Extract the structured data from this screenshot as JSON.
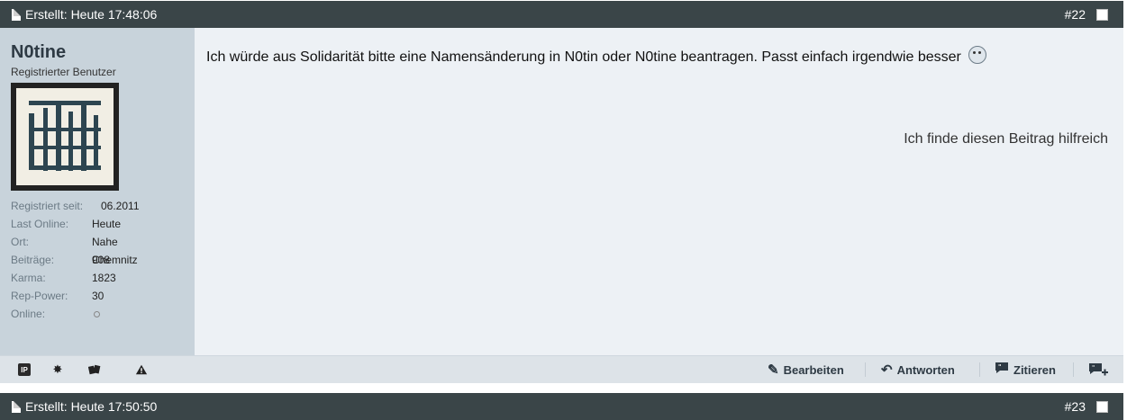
{
  "post1": {
    "created": "Erstellt: Heute 17:48:06",
    "number": "#22",
    "user": {
      "name": "N0tine",
      "title": "Registrierter Benutzer",
      "stats": [
        {
          "label": "Registriert seit:",
          "value": "06.2011"
        },
        {
          "label": "Last Online:",
          "value": "Heute"
        },
        {
          "label": "Ort:",
          "value": "Nahe Chemnitz"
        },
        {
          "label": "Beiträge:",
          "value": "908"
        },
        {
          "label": "Karma:",
          "value": "1823"
        },
        {
          "label": "Rep-Power:",
          "value": "30"
        },
        {
          "label": "Online:",
          "value": ""
        }
      ]
    },
    "message": "Ich würde aus Solidarität bitte eine Namensänderung in N0tin oder N0tine beantragen. Passt einfach irgendwie besser",
    "helpful": "Ich finde diesen Beitrag hilfreich",
    "actions": {
      "edit": "Bearbeiten",
      "reply": "Antworten",
      "quote": "Zitieren"
    },
    "icons": {
      "ip": "IP",
      "status": "star-icon",
      "cards": "cards-icon",
      "report": "warning-icon",
      "multiquote": "quote-plus-icon"
    }
  },
  "post2": {
    "created": "Erstellt: Heute 17:50:50",
    "number": "#23"
  },
  "colors": {
    "header": "#3a4548",
    "userbar": "#c8d3db",
    "content": "#edf1f5",
    "toolbar": "#dde3e8"
  }
}
